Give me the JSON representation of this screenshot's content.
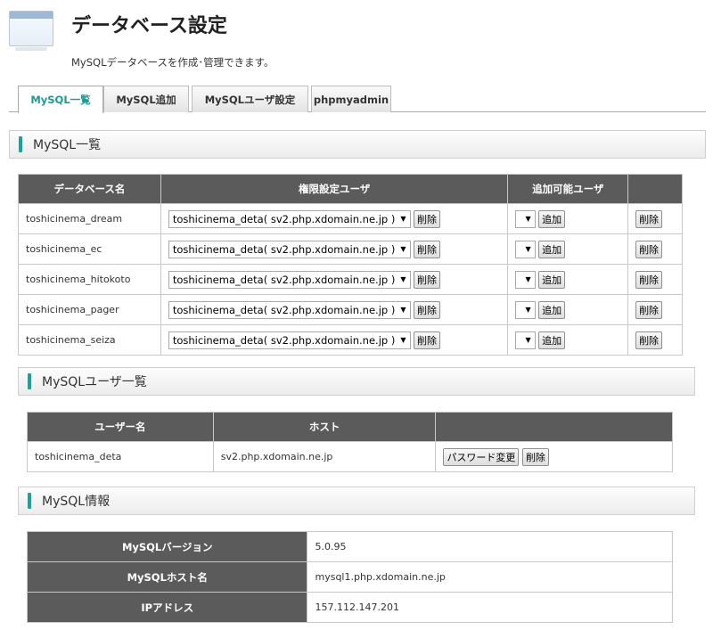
{
  "header": {
    "title": "データベース設定",
    "description": "MySQLデータベースを作成･管理できます。"
  },
  "tabs": [
    {
      "label": "MySQL一覧",
      "active": true
    },
    {
      "label": "MySQL追加"
    },
    {
      "label": "MySQLユーザ設定"
    },
    {
      "label": "phpmyadmin"
    }
  ],
  "db_list": {
    "heading": "MySQL一覧",
    "columns": [
      "データベース名",
      "権限設定ユーザ",
      "追加可能ユーザ",
      ""
    ],
    "rows": [
      {
        "name": "toshicinema_dream",
        "user": "toshicinema_deta( sv2.php.xdomain.ne.jp )"
      },
      {
        "name": "toshicinema_ec",
        "user": "toshicinema_deta( sv2.php.xdomain.ne.jp )"
      },
      {
        "name": "toshicinema_hitokoto",
        "user": "toshicinema_deta( sv2.php.xdomain.ne.jp )"
      },
      {
        "name": "toshicinema_pager",
        "user": "toshicinema_deta( sv2.php.xdomain.ne.jp )"
      },
      {
        "name": "toshicinema_seiza",
        "user": "toshicinema_deta( sv2.php.xdomain.ne.jp )"
      }
    ],
    "delete_label": "削除",
    "add_label": "追加",
    "empty_select": ""
  },
  "user_list": {
    "heading": "MySQLユーザ一覧",
    "columns": [
      "ユーザー名",
      "ホスト",
      ""
    ],
    "rows": [
      {
        "user": "toshicinema_deta",
        "host": "sv2.php.xdomain.ne.jp"
      }
    ],
    "password_label": "パスワード変更",
    "delete_label": "削除"
  },
  "info": {
    "heading": "MySQL情報",
    "rows": [
      {
        "label": "MySQLバージョン",
        "value": "5.0.95"
      },
      {
        "label": "MySQLホスト名",
        "value": "mysql1.php.xdomain.ne.jp"
      },
      {
        "label": "IPアドレス",
        "value": "157.112.147.201"
      }
    ]
  },
  "colors": {
    "accent": "#1aa39a",
    "header_bg": "#5b5b5b"
  }
}
